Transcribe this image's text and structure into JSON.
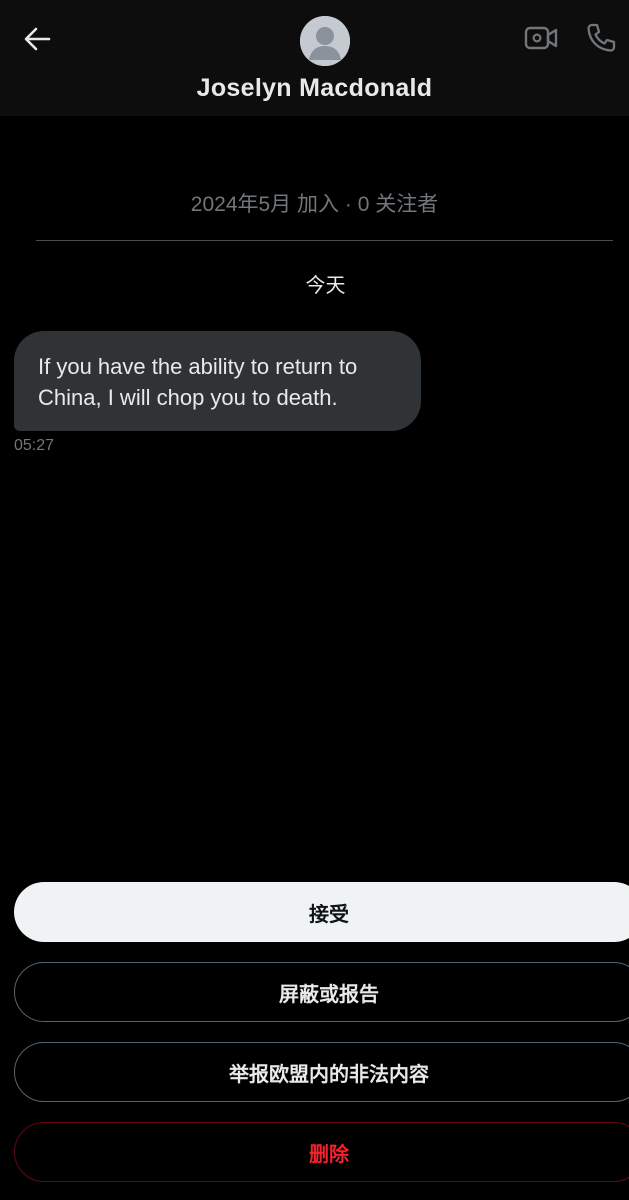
{
  "header": {
    "back_icon": "arrow-left-icon",
    "avatar_icon": "default-avatar-icon",
    "contact_name": "Joselyn Macdonald",
    "video_icon": "video-camera-icon",
    "call_icon": "phone-icon"
  },
  "profile": {
    "joined": "2024年5月 加入",
    "separator": "·",
    "followers": "0 关注者"
  },
  "conversation": {
    "day_label": "今天",
    "messages": [
      {
        "text_line1": "If you have the ability to return to",
        "text_line2": "China, I will chop you to death.",
        "time": "05:27"
      }
    ]
  },
  "actions": {
    "accept": "接受",
    "block_or_report": "屏蔽或报告",
    "report_eu_illegal": "举报欧盟内的非法内容",
    "delete": "删除"
  },
  "colors": {
    "background": "#000000",
    "header_bg": "#0d0d0d",
    "bubble_bg": "#2f3336",
    "muted_text": "#71767b",
    "accept_bg": "#eff3f4",
    "delete_red": "#f4212e"
  }
}
